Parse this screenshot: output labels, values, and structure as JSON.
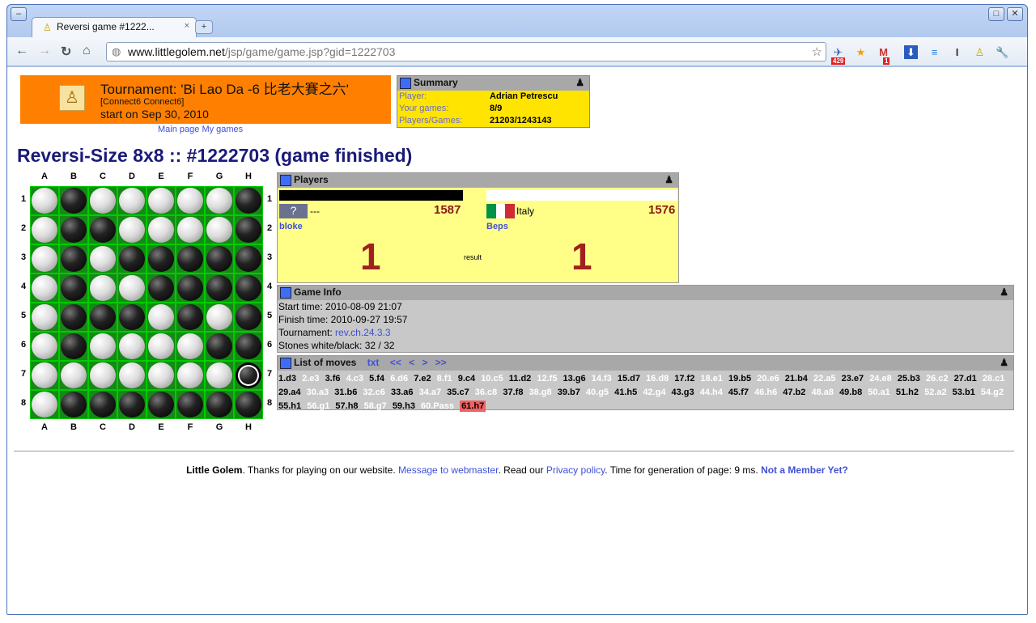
{
  "browser": {
    "tab_title": "Reversi game #1222...",
    "tab_close": "×",
    "new_tab": "+",
    "url_domain": "www.littlegolem.net",
    "url_path": "/jsp/game/game.jsp?gid=1222703",
    "ext_badge_1": "429",
    "ext_badge_2": "1"
  },
  "tournament": {
    "title": "Tournament: 'Bi Lao Da -6 比老大賽之六'",
    "subtitle": "[Connect6 Connect6]",
    "start": "start on Sep 30, 2010"
  },
  "links": {
    "main_page": "Main page",
    "my_games": "My games"
  },
  "summary": {
    "header": "Summary",
    "rows": [
      {
        "k": "Player:",
        "v": "Adrian Petrescu"
      },
      {
        "k": "Your games:",
        "v": "8/9"
      },
      {
        "k": "Players/Games:",
        "v": "21203/1243143"
      }
    ]
  },
  "game_title": "Reversi-Size 8x8 :: #1222703 (game finished)",
  "board": {
    "cols": [
      "A",
      "B",
      "C",
      "D",
      "E",
      "F",
      "G",
      "H"
    ],
    "rows": [
      "1",
      "2",
      "3",
      "4",
      "5",
      "6",
      "7",
      "8"
    ],
    "cells": [
      "WBWWWWWB",
      "WBBWWWWB",
      "WBWBBBBB",
      "WBWWBBBB",
      "WBBBWBWB",
      "WBWWWWBB",
      "WWWWWWWB",
      "WBBBBBBB"
    ],
    "last_move": "H7"
  },
  "players": {
    "header": "Players",
    "p1": {
      "badge": "?",
      "country": "---",
      "rating": "1587",
      "name": "bloke",
      "score": "1"
    },
    "p2": {
      "country": "Italy",
      "rating": "1576",
      "name": "Beps",
      "score": "1"
    },
    "result_label": "result",
    "flag_colors": [
      "#009246",
      "#ffffff",
      "#ce2b37"
    ]
  },
  "game_info": {
    "header": "Game Info",
    "start": "Start time: 2010-08-09 21:07",
    "finish": "Finish time: 2010-09-27 19:57",
    "tournament_label": "Tournament: ",
    "tournament_link": "rev.ch.24.3.3",
    "stones": "Stones white/black: 32 / 32"
  },
  "moves": {
    "header": "List of moves",
    "txt": "txt",
    "nav": [
      "<<",
      "<",
      ">",
      ">>"
    ],
    "list": [
      "1.d3",
      "2.e3",
      "3.f6",
      "4.c3",
      "5.f4",
      "6.d6",
      "7.e2",
      "8.f1",
      "9.c4",
      "10.c5",
      "11.d2",
      "12.f5",
      "13.g6",
      "14.f3",
      "15.d7",
      "16.d8",
      "17.f2",
      "18.e1",
      "19.b5",
      "20.e6",
      "21.b4",
      "22.a5",
      "23.e7",
      "24.e8",
      "25.b3",
      "26.c2",
      "27.d1",
      "28.c1",
      "29.a4",
      "30.a3",
      "31.b6",
      "32.c6",
      "33.a6",
      "34.a7",
      "35.c7",
      "36.c8",
      "37.f8",
      "38.g8",
      "39.b7",
      "40.g5",
      "41.h5",
      "42.g4",
      "43.g3",
      "44.h4",
      "45.f7",
      "46.h6",
      "47.b2",
      "48.a8",
      "49.b8",
      "50.a1",
      "51.h2",
      "52.a2",
      "53.b1",
      "54.g2",
      "55.h1",
      "56.g1",
      "57.h8",
      "58.g7",
      "59.h3",
      "60.Pass",
      "61.h7"
    ]
  },
  "footer": {
    "brand": "Little Golem",
    "thanks": ". Thanks for playing on our website. ",
    "webmaster": "Message to webmaster",
    "read": ". Read our ",
    "privacy": "Privacy policy",
    "time": ". Time for generation of page: 9 ms. ",
    "member": "Not a Member Yet?"
  }
}
